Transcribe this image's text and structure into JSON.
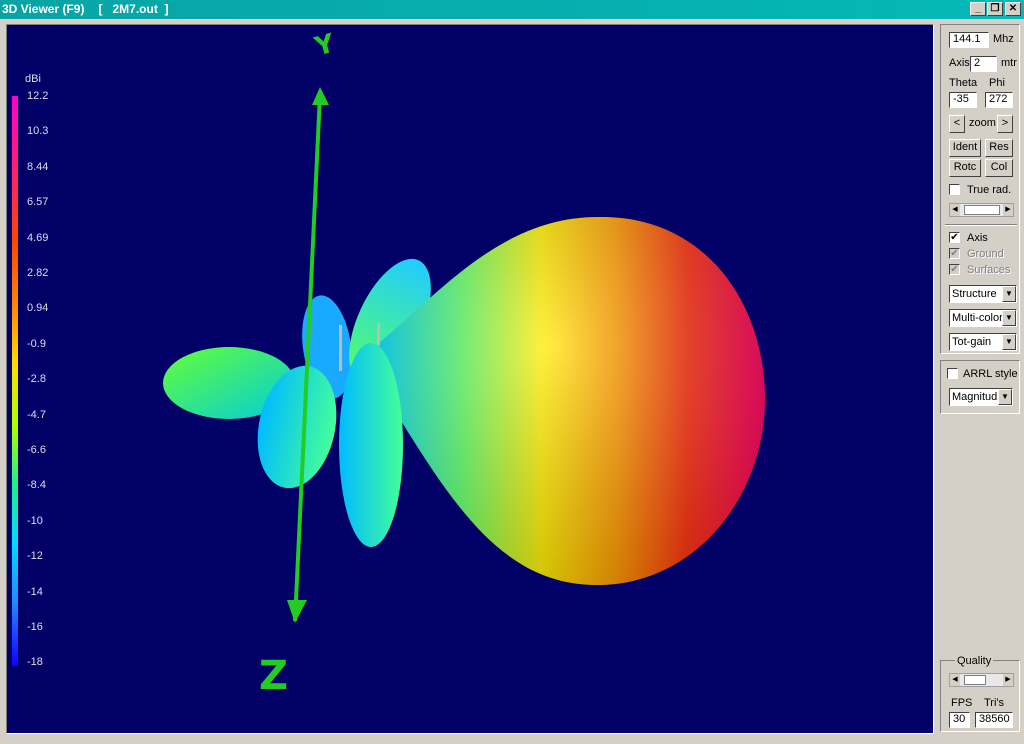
{
  "window": {
    "title": "3D Viewer (F9)",
    "file": "[   2M7.out  ]"
  },
  "window_buttons": {
    "minimize": "_",
    "restore": "❐",
    "close": "✕"
  },
  "scale": {
    "unit": "dBi",
    "labels": [
      "12.2",
      "10.3",
      "8.44",
      "6.57",
      "4.69",
      "2.82",
      "0.94",
      "-0.9",
      "-2.8",
      "-4.7",
      "-6.6",
      "-8.4",
      "-10",
      "-12",
      "-14",
      "-16",
      "-18"
    ]
  },
  "axes": {
    "top": "Y",
    "bottom": "Z"
  },
  "controls": {
    "frequency": "144.1",
    "freq_unit": "Mhz",
    "axis_label": "Axis",
    "axis_value": "2",
    "axis_unit": "mtr",
    "theta_label": "Theta",
    "phi_label": "Phi",
    "theta": "-35",
    "phi": "272",
    "zoom_prev": "<",
    "zoom_label": "zoom",
    "zoom_next": ">",
    "ident": "Ident",
    "res": "Res",
    "rotc": "Rotc",
    "col": "Col",
    "true_rad": "True rad.",
    "axis_check": "Axis",
    "ground": "Ground",
    "surfaces": "Surfaces",
    "structure": "Structure",
    "color_mode": "Multi-color",
    "gain_mode": "Tot-gain",
    "arrl": "ARRL style",
    "magnitude": "Magnitud",
    "quality": "Quality",
    "fps_label": "FPS",
    "tris_label": "Tri's",
    "fps": "30",
    "tris": "38560"
  },
  "state": {
    "true_rad": false,
    "axis": true,
    "ground": true,
    "surfaces": true,
    "arrl": false
  }
}
